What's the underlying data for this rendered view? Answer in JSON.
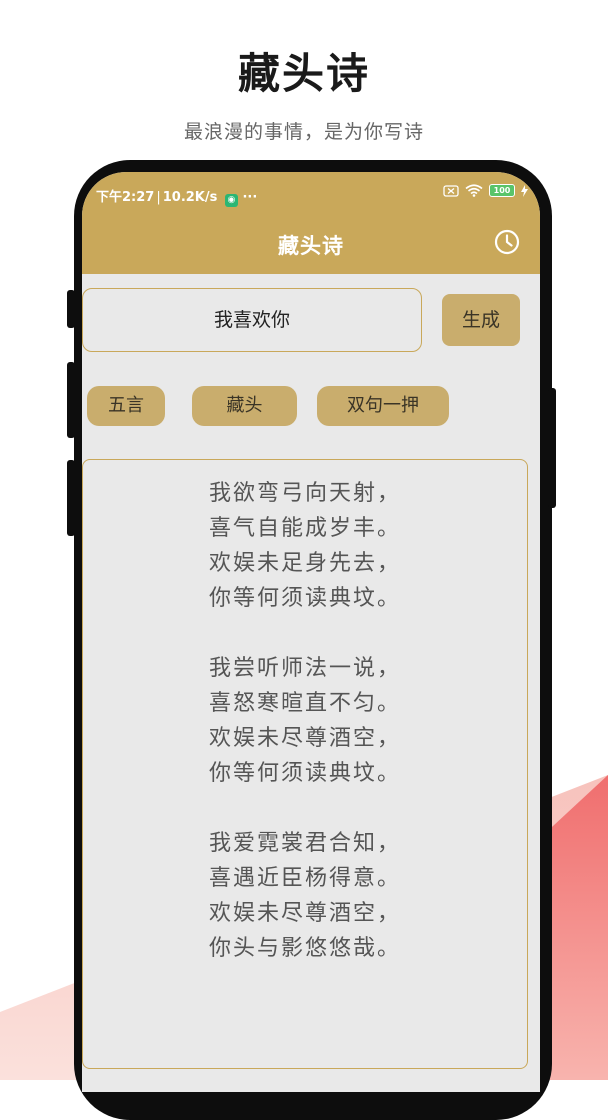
{
  "promo": {
    "title": "藏头诗",
    "subtitle": "最浪漫的事情，是为你写诗"
  },
  "status_bar": {
    "time": "下午2:27",
    "network_speed": "10.2K/s",
    "more": "···",
    "battery": "100"
  },
  "app_bar": {
    "title": "藏头诗",
    "history_icon": "clock-icon"
  },
  "input": {
    "value": "我喜欢你"
  },
  "generate_button": {
    "label": "生成"
  },
  "options": [
    {
      "label": "五言"
    },
    {
      "label": "藏头"
    },
    {
      "label": "双句一押"
    }
  ],
  "poems": [
    {
      "lines": [
        "我欲弯弓向天射，",
        "喜气自能成岁丰。",
        "欢娱未足身先去，",
        "你等何须读典坟。"
      ]
    },
    {
      "lines": [
        "我尝听师法一说，",
        "喜怒寒暄直不匀。",
        "欢娱未尽尊酒空，",
        "你等何须读典坟。"
      ]
    },
    {
      "lines": [
        "我爱霓裳君合知，",
        "喜遇近臣杨得意。",
        "欢娱未尽尊酒空，",
        "你头与影悠悠哉。"
      ]
    }
  ],
  "colors": {
    "accent": "#c9a85a",
    "chip": "#c9ad6d",
    "screen_bg": "#e9e9e9",
    "decor_red": "#ef7f7f"
  }
}
